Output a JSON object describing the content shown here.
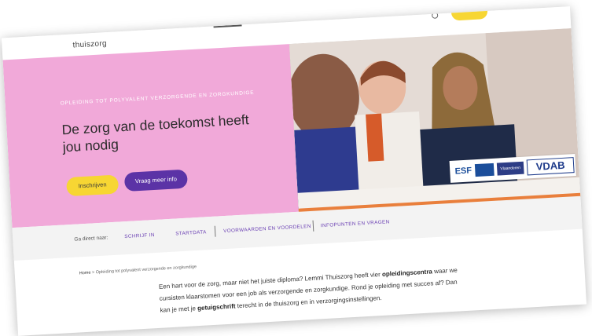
{
  "header": {
    "brand": "thuiszorg"
  },
  "hero": {
    "eyebrow": "OPLEIDING TOT POLYVALENT VERZORGENDE EN ZORGKUNDIGE",
    "title": "De zorg van de toekomst heeft jou nodig",
    "primary_button": "Inschrijven",
    "secondary_button": "Vraag meer info"
  },
  "logos": {
    "esf": "ESF",
    "vlaanderen": "Vlaanderen",
    "vdab": "VDAB"
  },
  "subnav": {
    "label": "Ga direct naar:",
    "links": [
      "SCHRIJF IN",
      "STARTDATA",
      "VOORWAARDEN EN VOORDELEN",
      "INFOPUNTEN EN VRAGEN"
    ]
  },
  "breadcrumb": {
    "home": "Home",
    "current": "Opleiding tot polyvalent verzorgende en zorgkundige"
  },
  "intro": {
    "t1": "Een hart voor de zorg, maar niet het juiste diploma? Lemmi Thuiszorg heeft vier ",
    "b1": "opleidingscentra",
    "t2": " waar we cursisten klaarstomen voor een job als verzorgende en zorgkundige. Rond je opleiding met succes af? Dan kan je met je ",
    "b2": "getuigschrift",
    "t3": " terecht in de thuiszorg en in verzorgingsinstellingen."
  },
  "colors": {
    "hero_pink": "#f1a9d9",
    "accent_yellow": "#f7d633",
    "accent_purple": "#5b33a6",
    "photo_bar_orange": "#e97f3c"
  }
}
